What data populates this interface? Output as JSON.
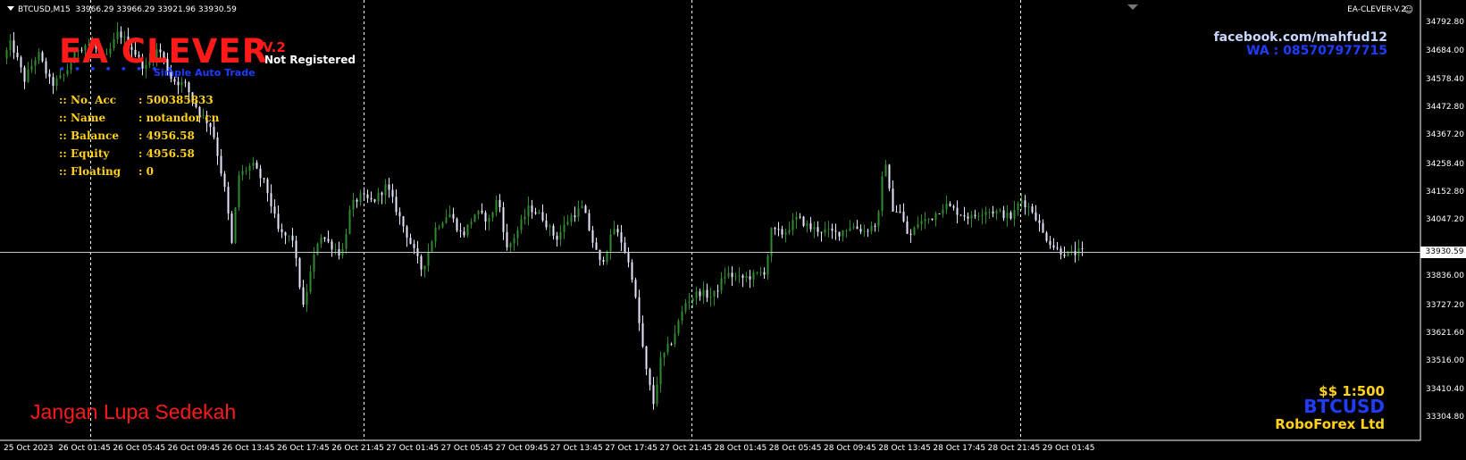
{
  "header": {
    "symbol_timeframe": "BTCUSD,M15",
    "ohlc": "33966.29 33966.29 33921.96 33930.59"
  },
  "ea_panel": {
    "title": "EA CLEVER",
    "version": "V.2",
    "registration": "Not Registered",
    "dots": "• • • • • • • •",
    "tagline": "Simple Auto Trade",
    "rows": [
      {
        "key": ":: No. Acc",
        "value": ": 500385833"
      },
      {
        "key": ":: Name",
        "value": ": notandor cn"
      },
      {
        "key": ":: Balance",
        "value": ": 4956.58"
      },
      {
        "key": ":: Equity",
        "value": ": 4956.58"
      },
      {
        "key": ":: Floating",
        "value": ": 0"
      }
    ]
  },
  "contact": {
    "facebook": "facebook.com/mahfud12",
    "whatsapp": "WA : 085707977715"
  },
  "footer": {
    "message": "Jangan Lupa Sedekah",
    "leverage": "$$ 1:500",
    "symbol": "BTCUSD",
    "broker": "RoboForex Ltd"
  },
  "ea_name": "EA-CLEVER-V.2",
  "smiley_icon": "☺",
  "current_price": "33930.59",
  "colors": {
    "background": "#000000",
    "bull_candle": "#2e8b2e",
    "bear_candle": "#e6e6ff",
    "grid_line": "#ffffff",
    "title_red": "#ff1a1a",
    "info_yellow": "#ffd11a",
    "accent_blue": "#1f3cff"
  },
  "chart_data": {
    "type": "candlestick",
    "symbol": "BTCUSD",
    "timeframe": "M15",
    "y_ticks": [
      "34792.80",
      "34684.00",
      "34578.40",
      "34472.80",
      "34367.20",
      "34258.40",
      "34152.80",
      "34047.20",
      "33836.00",
      "33727.20",
      "33621.60",
      "33516.00",
      "33410.40",
      "33304.80"
    ],
    "ylim": [
      33300,
      34830
    ],
    "x_ticks": [
      "25 Oct 2023",
      "26 Oct 01:45",
      "26 Oct 05:45",
      "26 Oct 09:45",
      "26 Oct 13:45",
      "26 Oct 17:45",
      "26 Oct 21:45",
      "27 Oct 01:45",
      "27 Oct 05:45",
      "27 Oct 09:45",
      "27 Oct 13:45",
      "27 Oct 17:45",
      "27 Oct 21:45",
      "28 Oct 01:45",
      "28 Oct 05:45",
      "28 Oct 09:45",
      "28 Oct 13:45",
      "28 Oct 17:45",
      "28 Oct 21:45",
      "29 Oct 01:45"
    ],
    "price_path": [
      [
        0,
        34620
      ],
      [
        15,
        34720
      ],
      [
        30,
        34580
      ],
      [
        45,
        34680
      ],
      [
        60,
        34560
      ],
      [
        75,
        34600
      ],
      [
        90,
        34700
      ],
      [
        105,
        34720
      ],
      [
        120,
        34650
      ],
      [
        135,
        34760
      ],
      [
        150,
        34700
      ],
      [
        165,
        34620
      ],
      [
        180,
        34700
      ],
      [
        195,
        34580
      ],
      [
        210,
        34560
      ],
      [
        225,
        34460
      ],
      [
        240,
        34400
      ],
      [
        255,
        34150
      ],
      [
        262,
        33960
      ],
      [
        270,
        34220
      ],
      [
        285,
        34260
      ],
      [
        300,
        34180
      ],
      [
        315,
        34000
      ],
      [
        330,
        33980
      ],
      [
        342,
        33720
      ],
      [
        350,
        33850
      ],
      [
        360,
        34000
      ],
      [
        375,
        33950
      ],
      [
        385,
        33920
      ],
      [
        395,
        34100
      ],
      [
        405,
        34140
      ],
      [
        420,
        34120
      ],
      [
        435,
        34180
      ],
      [
        445,
        34100
      ],
      [
        460,
        33980
      ],
      [
        475,
        33860
      ],
      [
        490,
        34020
      ],
      [
        505,
        34080
      ],
      [
        520,
        33990
      ],
      [
        535,
        34080
      ],
      [
        550,
        34050
      ],
      [
        560,
        34140
      ],
      [
        570,
        33940
      ],
      [
        580,
        34000
      ],
      [
        595,
        34100
      ],
      [
        610,
        34060
      ],
      [
        625,
        33980
      ],
      [
        640,
        34060
      ],
      [
        655,
        34100
      ],
      [
        665,
        33980
      ],
      [
        675,
        33880
      ],
      [
        690,
        34020
      ],
      [
        700,
        33960
      ],
      [
        710,
        33840
      ],
      [
        718,
        33660
      ],
      [
        726,
        33480
      ],
      [
        734,
        33360
      ],
      [
        742,
        33520
      ],
      [
        755,
        33600
      ],
      [
        770,
        33740
      ],
      [
        785,
        33780
      ],
      [
        800,
        33760
      ],
      [
        815,
        33850
      ],
      [
        830,
        33830
      ],
      [
        845,
        33840
      ],
      [
        860,
        33860
      ],
      [
        865,
        34010
      ],
      [
        880,
        34000
      ],
      [
        895,
        34060
      ],
      [
        910,
        34020
      ],
      [
        925,
        34010
      ],
      [
        940,
        34000
      ],
      [
        955,
        34030
      ],
      [
        970,
        34010
      ],
      [
        985,
        34040
      ],
      [
        993,
        34300
      ],
      [
        1000,
        34100
      ],
      [
        1010,
        34080
      ],
      [
        1020,
        33980
      ],
      [
        1030,
        34040
      ],
      [
        1045,
        34060
      ],
      [
        1060,
        34110
      ],
      [
        1075,
        34080
      ],
      [
        1090,
        34060
      ],
      [
        1105,
        34090
      ],
      [
        1120,
        34080
      ],
      [
        1135,
        34060
      ],
      [
        1145,
        34130
      ],
      [
        1160,
        34080
      ],
      [
        1170,
        34000
      ],
      [
        1185,
        33940
      ],
      [
        1200,
        33920
      ],
      [
        1210,
        33930
      ]
    ],
    "current_price": 33930.59,
    "period_separators": [
      "26 Oct 01:45",
      "26 Oct 21:45",
      "27 Oct 21:45",
      "28 Oct 21:45"
    ]
  }
}
